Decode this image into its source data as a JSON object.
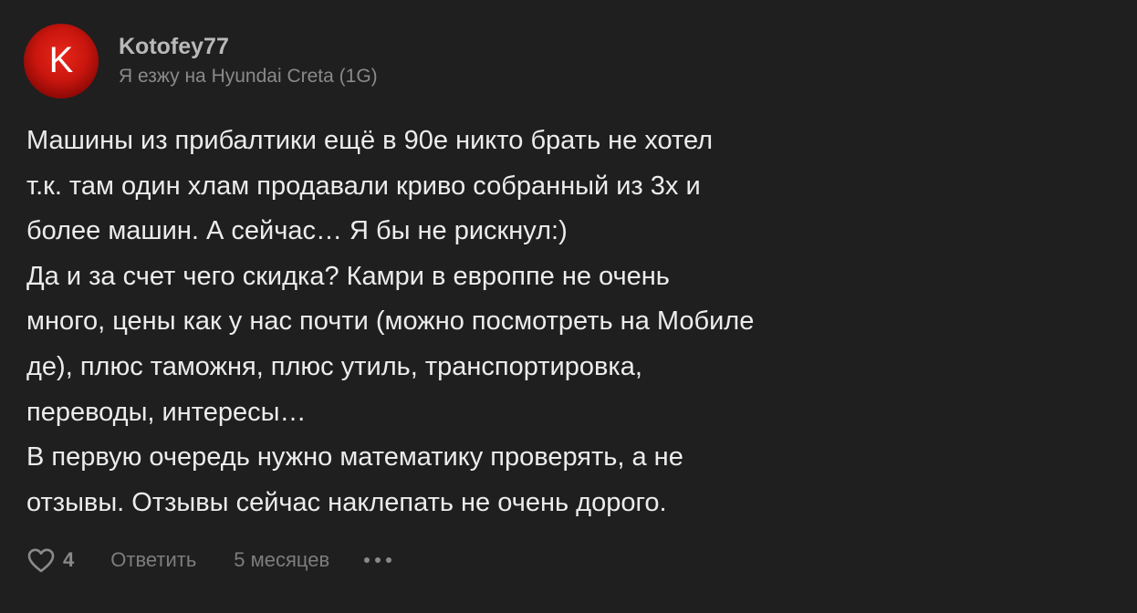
{
  "comment": {
    "author": {
      "avatar_letter": "K",
      "username": "Kotofey77",
      "car": "Я езжу на Hyundai Creta (1G)"
    },
    "text_lines": [
      "Машины из прибалтики ещё в 90е никто брать не хотел",
      "т.к. там один хлам продавали криво собранный из 3х и",
      "более машин. А сейчас… Я бы не рискнул:)",
      "Да и за счет чего скидка? Камри в европпе не очень",
      "много, цены как у нас почти (можно посмотреть на Мобиле",
      "де), плюс таможня, плюс утиль, транспортировка,",
      "переводы, интересы…",
      "В первую очередь нужно математику проверять, а не",
      "отзывы. Отзывы сейчас наклепать не очень дорого."
    ],
    "actions": {
      "like_icon": "heart-icon",
      "like_count": "4",
      "reply_label": "Ответить",
      "time": "5 месяцев",
      "more_icon": "more-dots-icon"
    }
  },
  "colors": {
    "background": "#1f1f1f",
    "text": "#ececec",
    "muted": "#8a8a8a",
    "avatar": "#c9160e"
  }
}
